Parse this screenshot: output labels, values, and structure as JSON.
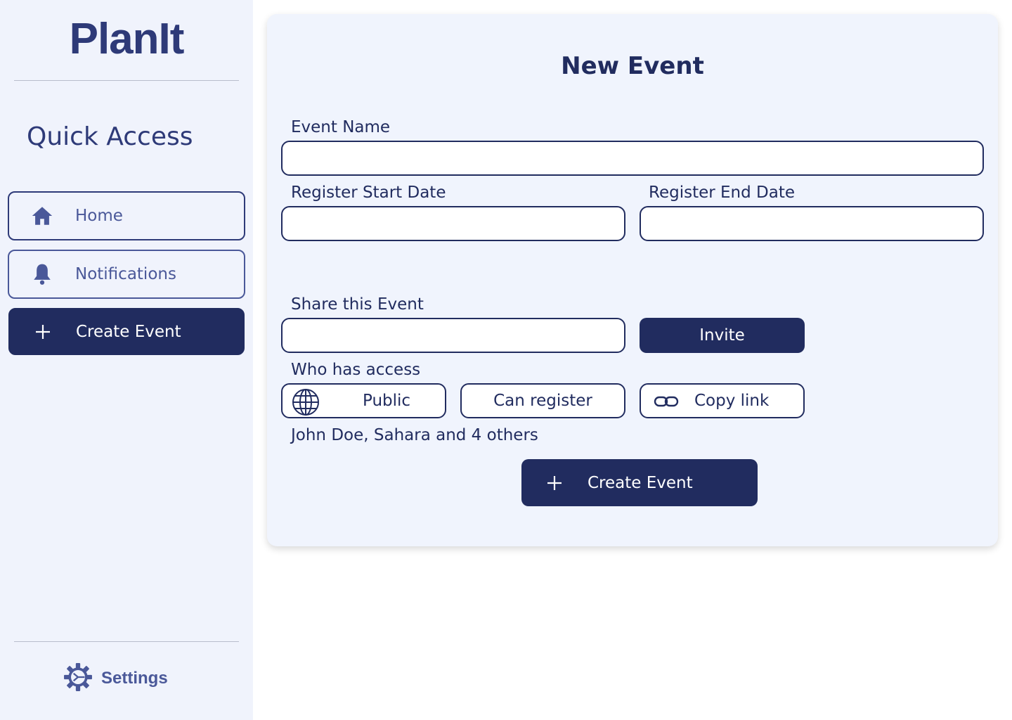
{
  "app": {
    "logo": "PlanIt"
  },
  "sidebar": {
    "section_title": "Quick Access",
    "items": [
      {
        "label": "Home",
        "icon": "home-icon"
      },
      {
        "label": "Notifications",
        "icon": "bell-icon"
      },
      {
        "label": "Create Event",
        "icon": "plus-icon"
      }
    ],
    "settings_label": "Settings"
  },
  "form": {
    "title": "New Event",
    "event_name": {
      "label": "Event Name",
      "value": ""
    },
    "register_start": {
      "label": "Register Start Date",
      "value": ""
    },
    "register_end": {
      "label": "Register End Date",
      "value": ""
    },
    "share": {
      "label": "Share this Event",
      "value": "",
      "invite_label": "Invite"
    },
    "access": {
      "label": "Who has access",
      "visibility": "Public",
      "permission": "Can register",
      "copy_link": "Copy link",
      "members": "John Doe, Sahara and 4 others"
    },
    "submit_label": "Create Event"
  },
  "colors": {
    "primary": "#212c5f",
    "accent": "#4a5899",
    "panel": "#f0f3fc"
  }
}
